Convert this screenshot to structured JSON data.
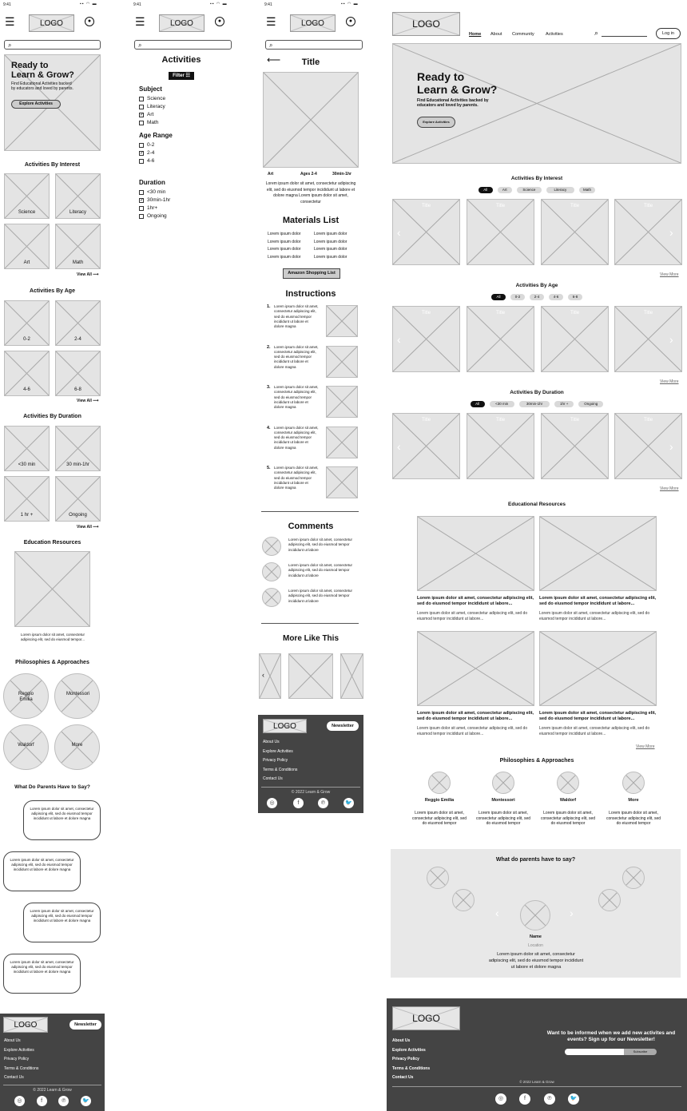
{
  "common": {
    "time": "9:41",
    "logo": "LOGO",
    "newsletter": "Newsletter",
    "footer_links": [
      "About Us",
      "Explore Activities",
      "Privacy Policy",
      "Terms & Conditions",
      "Contact Us"
    ],
    "copyright": "© 2022 Learn & Grow",
    "card_title": "Title",
    "lorem_short": "Lorem ipsum dolor sit amet, consectetur adipiscing elit, sed do eiusmod tempor...",
    "lorem_mid": "Lorem ipsum dolor sit amet, consectetur adipiscing elit, sed do eiusmod tempor incididunt ut labore et dolore magna",
    "lorem_comment": "Lorem ipsum dolor sit amet, consectetur adipiscing elit, sed do eiusmod tempor incididunt ut labore",
    "lorem_instr": "Lorem ipsum dolor sit amet, consectetur adipiscing elit, sed do eiusmod tempor incididunt ut labore et dolore magna",
    "view_all": "View All ⟶",
    "view_more": "View More",
    "icons": {
      "menu": "menu-icon",
      "account": "account-icon",
      "search": "search-icon"
    }
  },
  "mobile_home": {
    "hero_title": "Ready to\nLearn & Grow?",
    "hero_sub": "Find Educational Activities backed by educators and loved by parents.",
    "hero_btn": "Explore Activities",
    "interest_title": "Activities By Interest",
    "interest": [
      "Science",
      "Literacy",
      "Art",
      "Math"
    ],
    "age_title": "Activities By Age",
    "age": [
      "0-2",
      "2-4",
      "4-6",
      "6-8"
    ],
    "duration_title": "Activities By Duration",
    "duration": [
      "<30 min",
      "30 min-1hr",
      "1 hr +",
      "Ongoing"
    ],
    "resources_title": "Education Resources",
    "resources_text": "Lorem ipsum dolor sit amet, consectetur adipiscing elit, sed do eiusmod tempor...",
    "philo_title": "Philosophies & Approaches",
    "philo": [
      "Reggio Emilia",
      "Montessori",
      "Waldorf",
      "More"
    ],
    "parents_title": "What Do Parents Have to Say?"
  },
  "filter": {
    "title": "Activities",
    "filter_btn": "Filter ☷",
    "subject_title": "Subject",
    "subjects": [
      {
        "label": "Science",
        "checked": false
      },
      {
        "label": "Literacy",
        "checked": false
      },
      {
        "label": "Art",
        "checked": true
      },
      {
        "label": "Math",
        "checked": false
      }
    ],
    "age_title": "Age Range",
    "ages": [
      {
        "label": "0-2",
        "checked": false
      },
      {
        "label": "2-4",
        "checked": true
      },
      {
        "label": "4-6",
        "checked": false
      }
    ],
    "duration_title": "Duration",
    "durations": [
      {
        "label": "<30 min",
        "checked": false
      },
      {
        "label": "30min-1hr",
        "checked": true
      },
      {
        "label": "1hr+",
        "checked": false
      },
      {
        "label": "Ongoing",
        "checked": false
      }
    ]
  },
  "detail": {
    "title": "Title",
    "meta": [
      "Art",
      "Ages 2-4",
      "30min-1hr"
    ],
    "desc": "Lorem ipsum dolor sit amet, consectetur adipiscing elit, sed do eiusmod tempor incididunt ut labore et dolore magna Lorem ipsum dolor sit amet, consectetur",
    "materials_title": "Materials List",
    "material_item": "Lorem ipsum dolor",
    "amazon_btn": "Amazon Shopping List",
    "instructions_title": "Instructions",
    "steps": [
      "1.",
      "2.",
      "3.",
      "4.",
      "5."
    ],
    "comments_title": "Comments",
    "more_title": "More Like This"
  },
  "desktop": {
    "nav": [
      "Home",
      "About",
      "Community",
      "Activities"
    ],
    "login": "Log in",
    "hero_title": "Ready to\nLearn & Grow?",
    "hero_sub": "Find Educational Activities backed by educators and loved by parents.",
    "hero_btn": "Explore Activities",
    "interest_title": "Activities By Interest",
    "interest_chips": [
      "All",
      "Art",
      "Science",
      "Literacy",
      "Math"
    ],
    "age_title": "Activities By Age",
    "age_chips": [
      "All",
      "0-2",
      "2-4",
      "4-6",
      "6-8"
    ],
    "duration_title": "Activities By Duration",
    "duration_chips": [
      "All",
      "<30 min",
      "30min-1hr",
      "1hr +",
      "Ongoing"
    ],
    "resources_title": "Educational Resources",
    "resource_heading": "Lorem ipsum dolor sit amet, consectetur adipiscing elit, sed do eiusmod tempor incididunt ut labore...",
    "resource_body": "Lorem ipsum dolor sit amet, consectetur adipiscing elit, sed do eiusmod tempor incididunt ut labore...",
    "philo_title": "Philosophies & Approaches",
    "philo": [
      "Reggio Emilia",
      "Montessori",
      "Waldorf",
      "More"
    ],
    "philo_text": "Lorem ipsum dolor sit amet, consectetur adipiscing elit, sed do eiusmod tempor",
    "parents_title": "What do parents have to say?",
    "parent_name": "Name",
    "parent_location": "Location",
    "parent_quote": "Lorem ipsum dolor sit amet, consectetur adipiscing elit, sed do eiusmod tempor incididunt ut labore et dolore magna",
    "newsletter_text": "Want to be informed when we add new activites and events? Sign up for our Newsletter!",
    "subscribe": "Subscribe"
  }
}
